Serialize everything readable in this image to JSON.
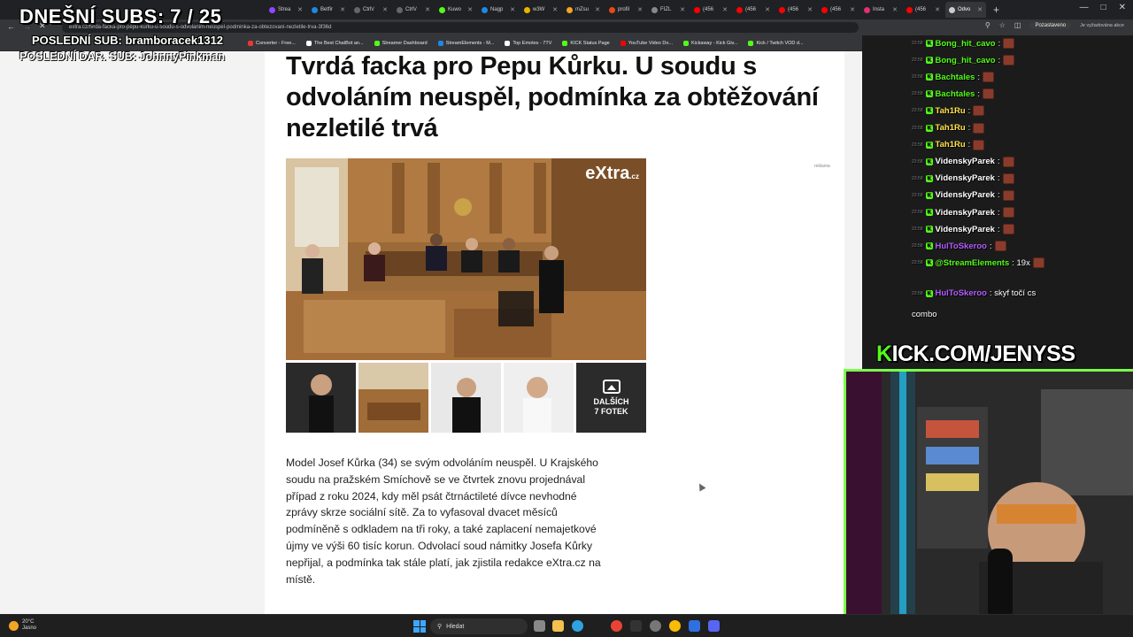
{
  "browser": {
    "tabs": [
      {
        "label": "Strea",
        "color": "#9146ff"
      },
      {
        "label": "Betfir",
        "color": "#1e88e5"
      },
      {
        "label": "Ctrl\\/",
        "color": "#666666"
      },
      {
        "label": "Ctrl\\/",
        "color": "#666666"
      },
      {
        "label": "Kuwo",
        "color": "#53fc18"
      },
      {
        "label": "Nagp",
        "color": "#1e88e5"
      },
      {
        "label": "w3W",
        "color": "#e8b400"
      },
      {
        "label": "mZsu",
        "color": "#f5a524"
      },
      {
        "label": "profil",
        "color": "#e64a19"
      },
      {
        "label": "FIZL",
        "color": "#888888"
      },
      {
        "label": "(456",
        "color": "#ff0000"
      },
      {
        "label": "(456",
        "color": "#ff0000"
      },
      {
        "label": "(456",
        "color": "#ff0000"
      },
      {
        "label": "(456",
        "color": "#ff0000"
      },
      {
        "label": "Insta",
        "color": "#e1306c"
      },
      {
        "label": "(456",
        "color": "#ff0000"
      },
      {
        "label": "Odvo",
        "color": "#cccccc",
        "active": true
      }
    ],
    "new_tab": "+",
    "url": "extra.cz/tvrda-facka-pro-pepu-kurku-u-soudu-s-odvolanim-neuspel-podminka-za-obtezovani-nezletile-trva-3f36d",
    "profile_label": "Pozastaveno",
    "profile_hint": "Je vyžadována akce",
    "bookmarks": [
      {
        "label": "Converter - Free...",
        "color": "#e53935"
      },
      {
        "label": "The Best ChatBot an...",
        "color": "#ffffff"
      },
      {
        "label": "Streamer Dashboard",
        "color": "#53fc18"
      },
      {
        "label": "StreamElements - M...",
        "color": "#1e88e5"
      },
      {
        "label": "Top Emotes - 7TV",
        "color": "#ffffff"
      },
      {
        "label": "KICK Status Page",
        "color": "#53fc18"
      },
      {
        "label": "YouTube Video Do...",
        "color": "#ff0000"
      },
      {
        "label": "Kickaway - Kick Giv...",
        "color": "#53fc18"
      },
      {
        "label": "Kick / Twitch VOD d...",
        "color": "#53fc18"
      }
    ]
  },
  "overlay": {
    "subs_today": "DNEŠNÍ SUBS: 7 / 25",
    "last_sub": "POSLEDNÍ SUB: bramboracek1312",
    "last_gift": "POSLEDNÍ DAR. SUB: JohnnyPinkman",
    "kick_channel_prefix": "K",
    "kick_channel_rest": "ICK.COM/JENYSS"
  },
  "article": {
    "headline": "Tvrdá facka pro Pepu Kůrku. U soudu s odvoláním neuspěl, podmínka za obtěžování nezletilé trvá",
    "image_logo": "eXtra",
    "image_logo_suffix": ".cz",
    "gallery_more_label": "DALŠÍCH",
    "gallery_more_count": "7 FOTEK",
    "body": "Model Josef Kůrka (34) se svým odvoláním neuspěl. U Krajského soudu na pražském Smíchově se ve čtvrtek znovu projednával případ z roku 2024, kdy měl psát čtrnáctileté dívce nevhodné zprávy skrze sociální sítě. Za to vyfasoval dvacet měsíců podmíněně s odkladem na tři roky, a také zaplacení nemajetkové újmy ve výši 60 tisíc korun. Odvolací soud námitky Josefa Kůrky nepřijal, a podmínka tak stále platí, jak zjistila redakce eXtra.cz na místě.",
    "ad_label": "reklama"
  },
  "chat": {
    "messages": [
      {
        "time": "23:58",
        "user": "Bong_hit_cavo",
        "color": "#53fc18",
        "text": ":"
      },
      {
        "time": "23:58",
        "user": "Bong_hit_cavo",
        "color": "#53fc18",
        "text": ":"
      },
      {
        "time": "23:58",
        "user": "Bachtales",
        "color": "#53fc18",
        "text": ":"
      },
      {
        "time": "23:58",
        "user": "Bachtales",
        "color": "#53fc18",
        "text": ":"
      },
      {
        "time": "23:58",
        "user": "Tah1Ru",
        "color": "#ffe14a",
        "text": ":"
      },
      {
        "time": "23:58",
        "user": "Tah1Ru",
        "color": "#ffe14a",
        "text": ":"
      },
      {
        "time": "23:58",
        "user": "Tah1Ru",
        "color": "#ffe14a",
        "text": ":"
      },
      {
        "time": "23:58",
        "user": "VidenskyParek",
        "color": "#ffffff",
        "text": ":"
      },
      {
        "time": "23:58",
        "user": "VidenskyParek",
        "color": "#ffffff",
        "text": ":"
      },
      {
        "time": "23:58",
        "user": "VidenskyParek",
        "color": "#ffffff",
        "text": ":"
      },
      {
        "time": "23:58",
        "user": "VidenskyParek",
        "color": "#ffffff",
        "text": ":"
      },
      {
        "time": "23:58",
        "user": "VidenskyParek",
        "color": "#ffffff",
        "text": ":"
      },
      {
        "time": "23:58",
        "user": "HulToSkeroo",
        "color": "#b35cff",
        "text": ":"
      },
      {
        "time": "23:58",
        "user": "@StreamElements",
        "color": "#53fc18",
        "text": ": 19x"
      },
      {
        "time": "23:58",
        "user": "HulToSkeroo",
        "color": "#b35cff",
        "text": ": skyf točí cs"
      }
    ],
    "combo_text": "combo"
  },
  "taskbar": {
    "temperature": "20°C",
    "weather_text": "Jasno",
    "search_placeholder": "Hledat"
  }
}
